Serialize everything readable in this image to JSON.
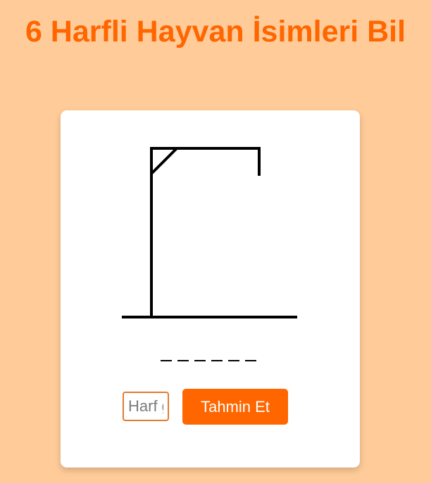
{
  "game": {
    "title": "6 Harfli Hayvan İsimleri Bil",
    "word_length": 6,
    "letter_input_placeholder": "Harf girin",
    "guess_button_label": "Tahmin Et"
  },
  "colors": {
    "background": "#ffcc99",
    "accent": "#ff6600",
    "card": "#ffffff"
  }
}
